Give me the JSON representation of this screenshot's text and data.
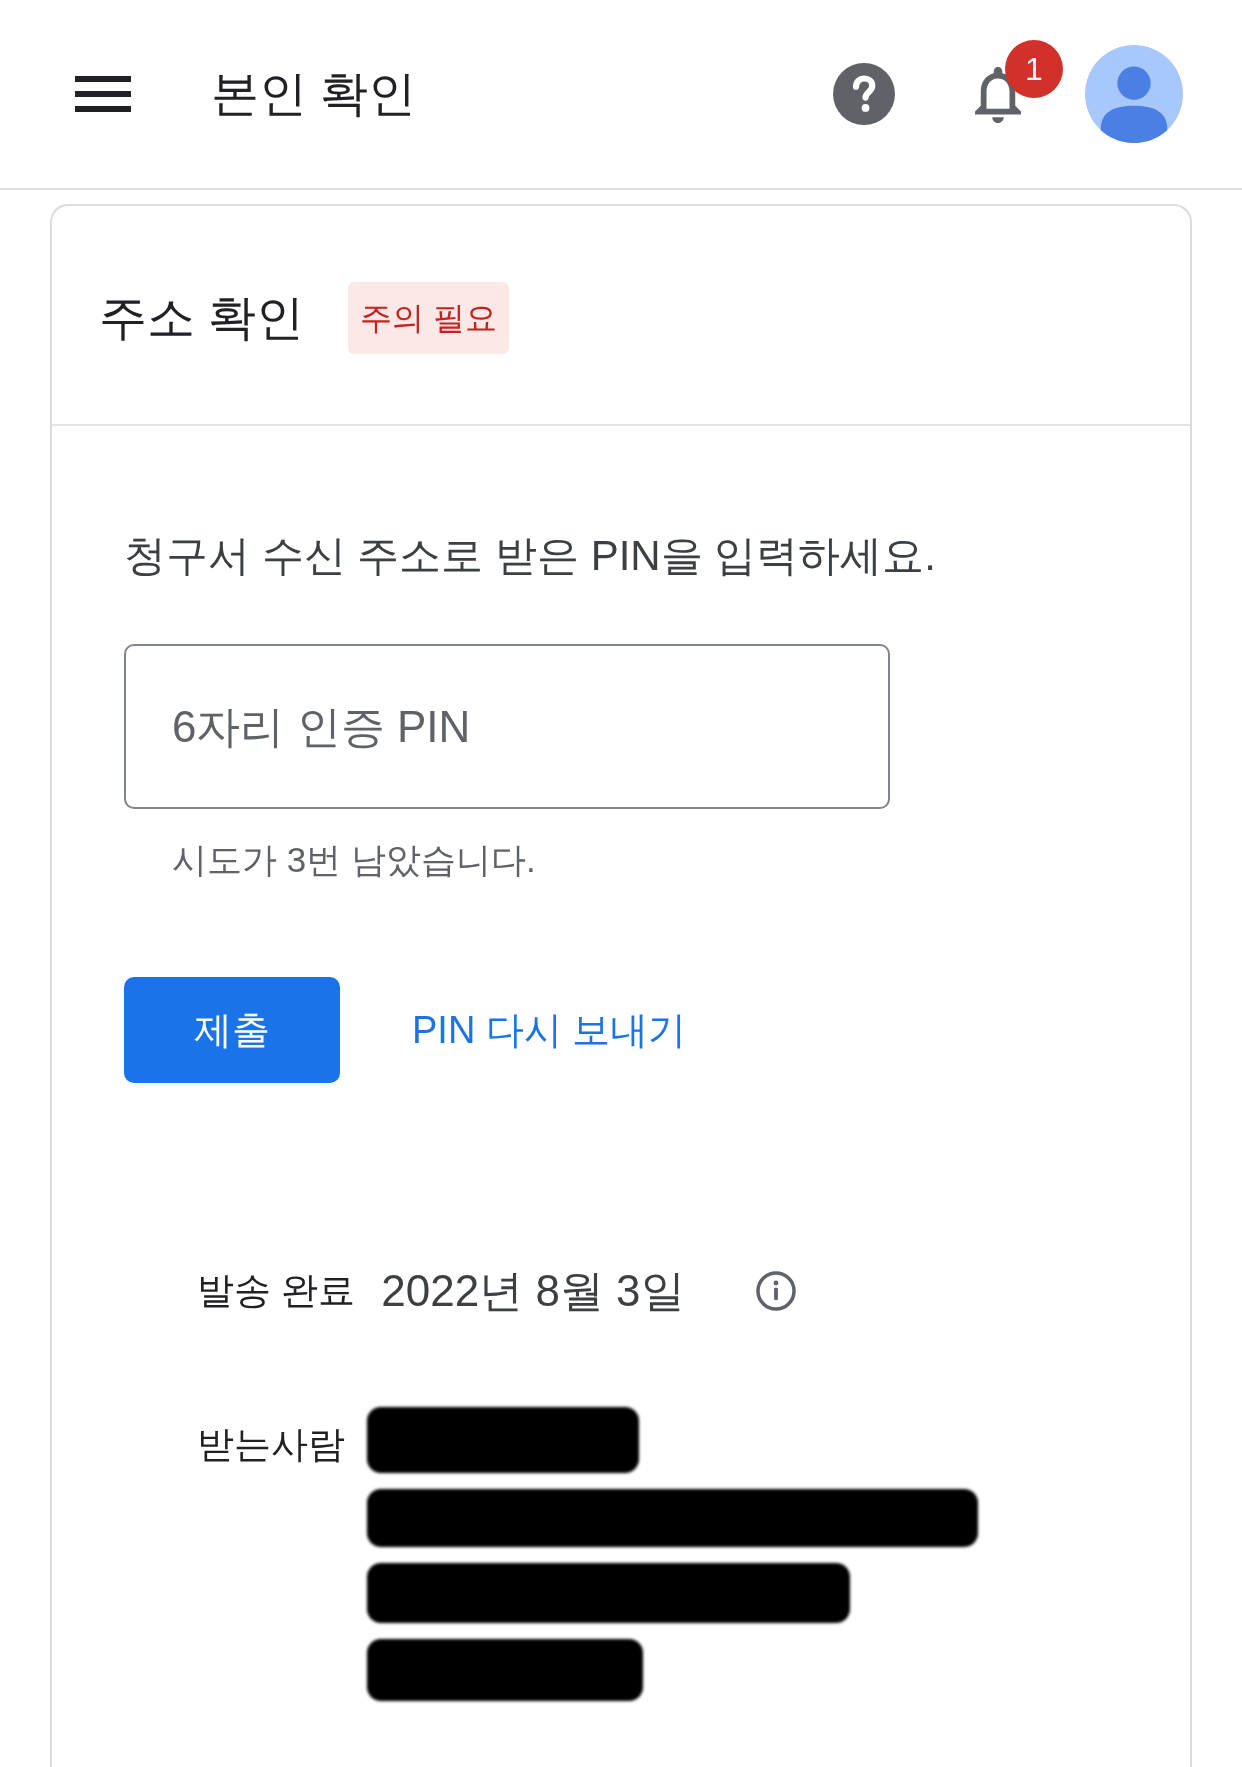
{
  "header": {
    "title": "본인 확인",
    "notifications": {
      "count": "1"
    }
  },
  "card": {
    "title": "주소 확인",
    "status": {
      "label": "주의 필요",
      "kind": "warning"
    },
    "instruction": "청구서 수신 주소로 받은 PIN을 입력하세요.",
    "pin_field": {
      "placeholder": "6자리 인증 PIN"
    },
    "helper_text": "시도가 3번 남았습니다.",
    "buttons": [
      {
        "label": "제출",
        "kind": "primary"
      },
      {
        "label": "PIN 다시 보내기",
        "kind": "text"
      }
    ],
    "details": [
      {
        "label": "발송 완료",
        "value": "2022년 8월 3일",
        "info": true,
        "redacted": false
      },
      {
        "label": "받는사람",
        "info": false,
        "redacted": true
      }
    ]
  }
}
